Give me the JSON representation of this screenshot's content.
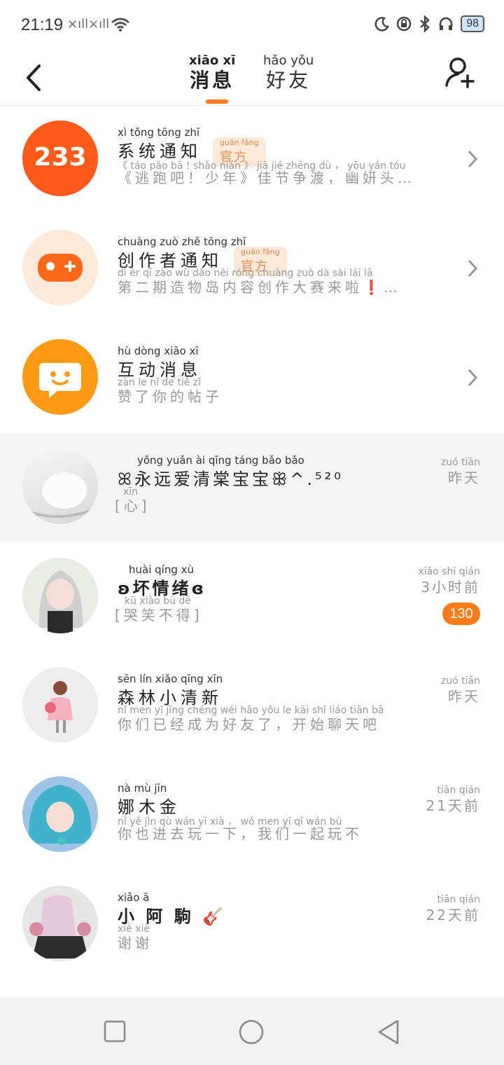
{
  "status_bar": {
    "time": "21:19",
    "signal1": "×ıll",
    "signal2": "×ıll",
    "battery": "98"
  },
  "header": {
    "tabs": [
      {
        "pinyin": "xiāo  xī",
        "label": "消息",
        "active": true
      },
      {
        "pinyin": "hǎo yǒu",
        "label": "好友",
        "active": false
      }
    ]
  },
  "items": [
    {
      "name_pinyin": "xì  tǒng tōng  zhī",
      "name": "系统通知",
      "badge_pinyin": "guān fāng",
      "badge": "官方",
      "sub_pinyin": "《 táo  pǎo  bā  !  shǎo nián 》 jiā  jié zhēng  dù ，  yōu yán tóu",
      "sub": "《逃跑吧！少年》佳节争渡，幽妍头…",
      "avatar_text": "233"
    },
    {
      "name_pinyin": "chuàng zuò zhě tōng zhī",
      "name": "创作者通知",
      "badge_pinyin": "guān fāng",
      "badge": "官方",
      "sub_pinyin": "dì  èr  qī  zào wù dǎo nèi róng chuàng zuò dà  sài  lái  lā",
      "sub": "第二期造物岛内容创作大赛来啦❗…"
    },
    {
      "name_pinyin": "hù dòng xiāo  xī",
      "name": "互动消息",
      "sub_pinyin": "zàn  le   nǐ   de  tiě   zǐ",
      "sub": "赞了你的帖子"
    },
    {
      "name_pinyin": "yǒng yuǎn  ài  qīng táng bǎo  bǎo",
      "name": "ꕤ永远爱清棠宝宝ꕥ^.⁵²⁰",
      "sub_pinyin": "xīn",
      "sub": "[心]",
      "time_pinyin": "zuó tiān",
      "time": "昨天",
      "highlight": true
    },
    {
      "name_pinyin": "huài qíng  xù",
      "name": "ʚ坏情绪ɞ",
      "sub_pinyin": "kū  xiào  bù   dé",
      "sub": "[哭笑不得]",
      "time_pinyin": "xiǎo shí  qián",
      "time": "3小时前",
      "unread": "130"
    },
    {
      "name_pinyin": "sēn  lín  xiǎo qīng xīn",
      "name": "森林小清新",
      "sub_pinyin": "nǐ  men  yǐ  jīng chéng wéi hǎo yǒu  le      kāi  shǐ liáo tiān  bā",
      "sub": "你们已经成为好友了，开始聊天吧",
      "time_pinyin": "zuó tiān",
      "time": "昨天"
    },
    {
      "name_pinyin": "nà  mù  jīn",
      "name": "娜木金",
      "sub_pinyin": "nǐ   yě   jìn  qù  wán  yī  xià  ，  wǒ men  yī   qǐ  wán  bù",
      "sub": "你也进去玩一下，我们一起玩不",
      "time_pinyin": "tiān qián",
      "time": "21天前"
    },
    {
      "name_pinyin": "xiǎo     ā",
      "name": "小 阿 駒 🎸",
      "sub_pinyin": "xiè  xiè",
      "sub": "谢谢",
      "time_pinyin": "tiān qián",
      "time": "22天前"
    }
  ],
  "colors": {
    "accent": "#ff7a1a",
    "official_badge_bg": "#fde9d9",
    "official_badge_text": "#f08a4b"
  }
}
